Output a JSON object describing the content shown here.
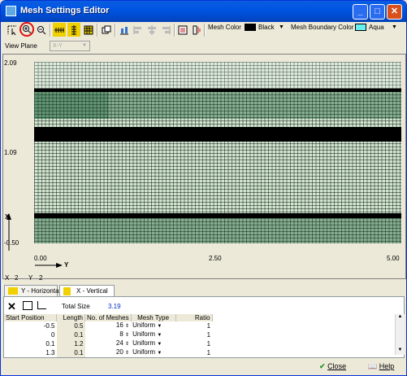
{
  "window": {
    "title": "Mesh Settings Editor",
    "min_glyph": "_",
    "max_glyph": "□",
    "close_glyph": "✕"
  },
  "toolbar": {
    "mesh_color_label": "Mesh Color",
    "mesh_color_value": "Black",
    "mesh_color_hex": "#000000",
    "boundary_color_label": "Mesh Boundary Color",
    "boundary_color_value": "Aqua",
    "boundary_color_hex": "#66f0f0"
  },
  "view_plane": {
    "label": "View Plane",
    "value": "X-Y"
  },
  "plot": {
    "y_ticks": [
      "2.09",
      "1.09",
      "-0.50"
    ],
    "x_ticks": [
      "0.00",
      "2.50",
      "5.00"
    ],
    "x_axis_name": "Y",
    "y_axis_name": "X",
    "grid_fill": "#cfe6cf",
    "band_color": "#000000"
  },
  "coords": {
    "x_label": "X",
    "x_value": "2",
    "y_label": "Y",
    "y_value": "2"
  },
  "tabs": [
    {
      "label": "Y - Horizontal",
      "active": false
    },
    {
      "label": "X - Vertical",
      "active": true
    }
  ],
  "panel": {
    "total_size_label": "Total Size",
    "total_size_value": "3.19"
  },
  "table": {
    "headers": [
      "Start Position",
      "Length",
      "No. of Meshes",
      "Mesh Type",
      "Ratio"
    ],
    "rows": [
      [
        "-0.5",
        "0.5",
        "16",
        "Uniform",
        "1"
      ],
      [
        "0",
        "0.1",
        "8",
        "Uniform",
        "1"
      ],
      [
        "0.1",
        "1.2",
        "24",
        "Uniform",
        "1"
      ],
      [
        "1.3",
        "0.1",
        "20",
        "Uniform",
        "1"
      ]
    ]
  },
  "footer": {
    "close_label": "Close",
    "help_label": "Help"
  }
}
